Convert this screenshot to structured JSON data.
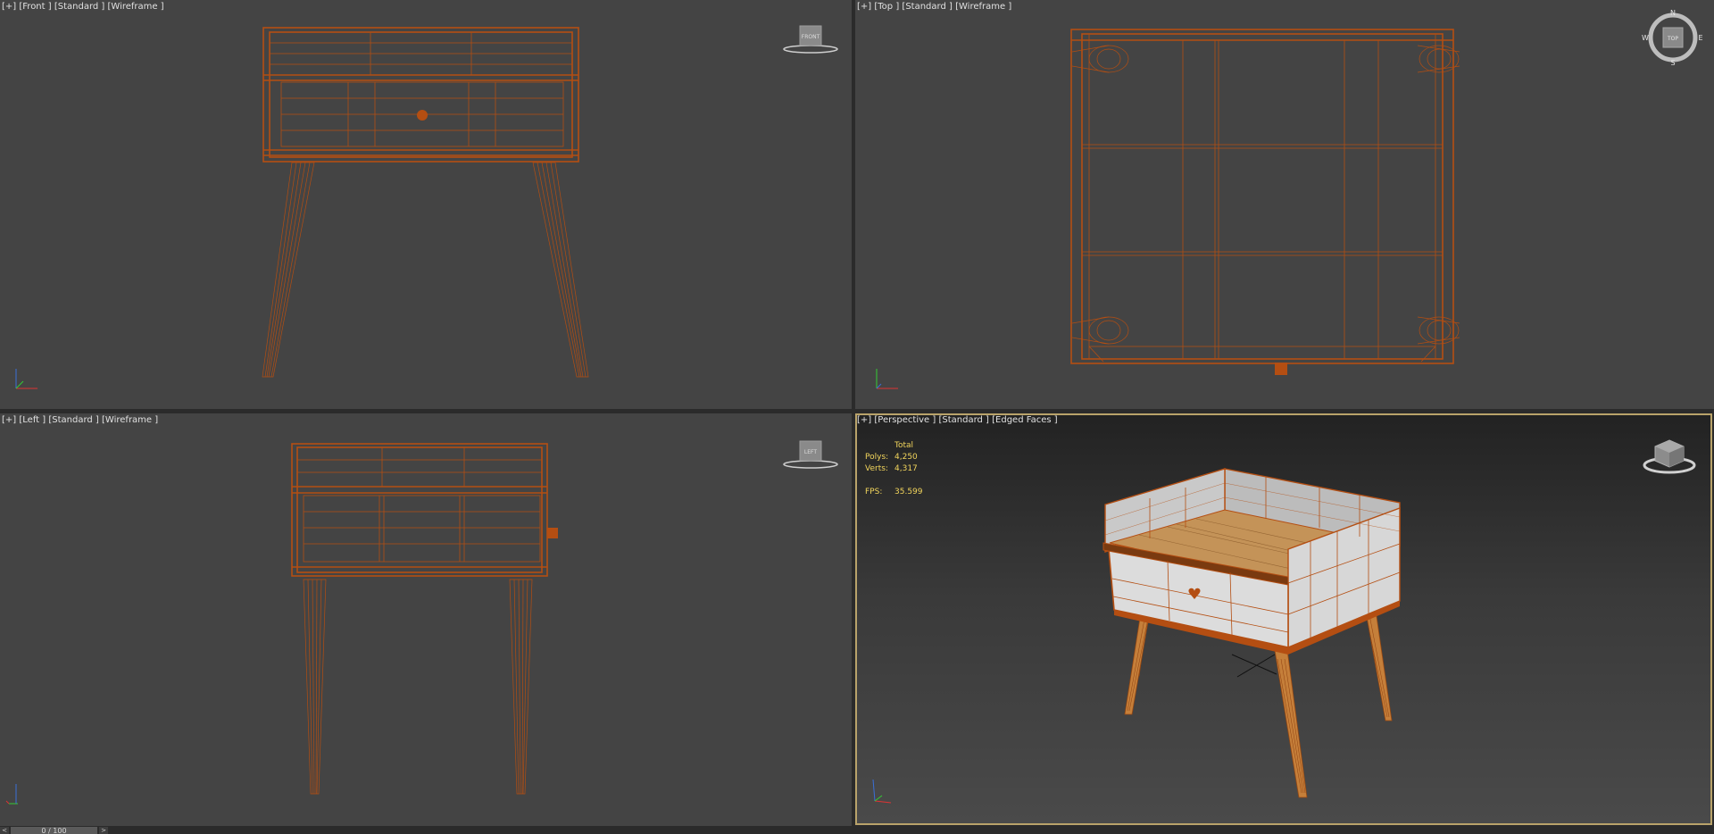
{
  "viewports": {
    "front": {
      "plus": "[+]",
      "view": "[Front ]",
      "mode": "[Standard ]",
      "shading": "[Wireframe ]",
      "cube_label": "FRONT"
    },
    "top": {
      "plus": "[+]",
      "view": "[Top ]",
      "mode": "[Standard ]",
      "shading": "[Wireframe ]",
      "cube_label": "TOP",
      "compass": {
        "n": "N",
        "s": "S",
        "e": "E",
        "w": "W"
      }
    },
    "left": {
      "plus": "[+]",
      "view": "[Left ]",
      "mode": "[Standard ]",
      "shading": "[Wireframe ]",
      "cube_label": "LEFT"
    },
    "perspective": {
      "plus": "[+]",
      "view": "[Perspective ]",
      "mode": "[Standard ]",
      "shading": "[Edged Faces ]",
      "stats": {
        "total_label": "Total",
        "polys_label": "Polys:",
        "polys_value": "4,250",
        "verts_label": "Verts:",
        "verts_value": "4,317",
        "fps_label": "FPS:",
        "fps_value": "35.599"
      }
    }
  },
  "timeline": {
    "prev": "<",
    "next": ">",
    "frame": "0 / 100"
  },
  "colors": {
    "wire": "#b44e12",
    "viewport_bg": "#444444",
    "active_border": "#b9a36a",
    "stats": "#f2d55c"
  }
}
